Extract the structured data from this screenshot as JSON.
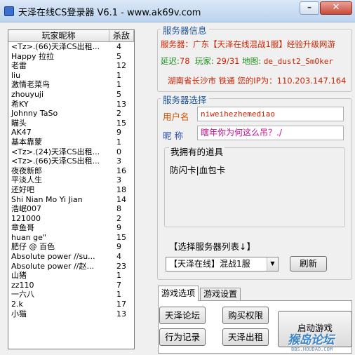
{
  "window": {
    "title": "天泽在线CS登录器 V6.1  -  www.ak69v.com",
    "minimize_glyph": "–",
    "close_glyph": "✕"
  },
  "player_list": {
    "headers": {
      "name": "玩家昵称",
      "kills": "杀敌"
    },
    "rows": [
      {
        "name": "<Tz>.(66)天泽CS出租...",
        "kills": "4"
      },
      {
        "name": "Happy  拉拉",
        "kills": "5"
      },
      {
        "name": "老雷",
        "kills": "12"
      },
      {
        "name": "liu",
        "kills": "1"
      },
      {
        "name": "激情老菜鸟",
        "kills": "1"
      },
      {
        "name": "zhouyuji",
        "kills": "5"
      },
      {
        "name": "希KY",
        "kills": "13"
      },
      {
        "name": "Johnny TaSo",
        "kills": "2"
      },
      {
        "name": "瞄头",
        "kills": "15"
      },
      {
        "name": "AK47",
        "kills": "9"
      },
      {
        "name": "基本靠蒙",
        "kills": "1"
      },
      {
        "name": "<Tz>.(24)天泽CS出租...",
        "kills": "0"
      },
      {
        "name": "<Tz>.(66)天泽CS出租...",
        "kills": "3"
      },
      {
        "name": "夜夜新郎",
        "kills": "16"
      },
      {
        "name": "平淡人生",
        "kills": "3"
      },
      {
        "name": "还好吧",
        "kills": "18"
      },
      {
        "name": "Shi Nian Mo Yi Jian",
        "kills": "14"
      },
      {
        "name": "浩岷007",
        "kills": "8"
      },
      {
        "name": "121000",
        "kills": "2"
      },
      {
        "name": "章鱼哥",
        "kills": "9"
      },
      {
        "name": "huan ge\"",
        "kills": "15"
      },
      {
        "name": "肥仔 @  百色",
        "kills": "9"
      },
      {
        "name": "Absolute power //su...",
        "kills": "4"
      },
      {
        "name": "Absolute power //赵...",
        "kills": "23"
      },
      {
        "name": "山猪",
        "kills": "1"
      },
      {
        "name": "zz110",
        "kills": "7"
      },
      {
        "name": "一六八",
        "kills": "1"
      },
      {
        "name": "2.k",
        "kills": "17"
      },
      {
        "name": "小猫",
        "kills": "13"
      }
    ]
  },
  "server_info": {
    "legend": "服务器信息",
    "region_line": "服务器：广东【天泽在线混战1服】经验升级网游",
    "latency_label": "延迟:",
    "latency_value": "78",
    "players_label": "玩家:",
    "players_value": "29/31",
    "map_label": "地图:",
    "map_value": "de_dust2_SmOker",
    "location_line": "湖南省长沙市 铁通 您的IP为：110.203.147.164"
  },
  "server_select": {
    "legend": "服务器选择",
    "username_label": "用户名",
    "username_value": "niweihezhemediao",
    "nickname_label": "昵  称",
    "nickname_value": "瞎年你为何这么吊？./",
    "items_title": "我拥有的道具",
    "items_value": "防闪卡|血包卡",
    "server_list_label": "【选择服务器列表↓】",
    "server_dropdown_value": "【天泽在线】混战1服",
    "refresh_label": "刷新"
  },
  "tabs": {
    "options_label": "游戏选项",
    "settings_label": "游戏设置"
  },
  "actions": {
    "forum_label": "天泽论坛",
    "buy_label": "购买权限",
    "record_label": "行为记录",
    "rent_label": "天泽出租",
    "launch_label": "启动游戏"
  },
  "watermark": {
    "title": "猴岛论坛",
    "url": "BBS.HOUDAO.COM"
  },
  "colors": {
    "legend_blue": "#20569a",
    "info_red": "#cc2200",
    "info_green": "#1a8a1a"
  }
}
